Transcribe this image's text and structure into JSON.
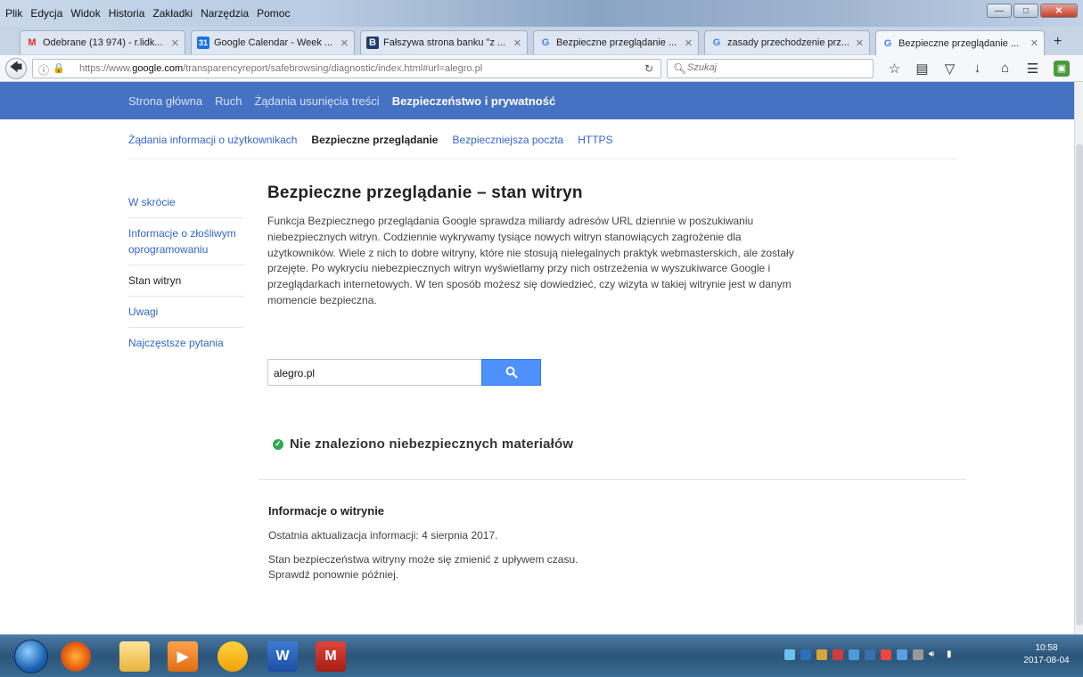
{
  "browser": {
    "menu": [
      "Plik",
      "Edycja",
      "Widok",
      "Historia",
      "Zakładki",
      "Narzędzia",
      "Pomoc"
    ],
    "tabs": [
      {
        "label": "Odebrane (13 974) - r.lidk...",
        "icon": "gmail-icon",
        "color": "#d93025"
      },
      {
        "label": "Google Calendar - Week ...",
        "icon": "calendar-icon",
        "color": "#1a73e8"
      },
      {
        "label": "Fałszywa strona banku \"z ...",
        "icon": "news-icon",
        "color": "#1f3b70"
      },
      {
        "label": "Bezpieczne przeglądanie ...",
        "icon": "google-icon",
        "color": "#4285f4"
      },
      {
        "label": "zasady przechodzenie prz...",
        "icon": "google-icon",
        "color": "#4285f4"
      },
      {
        "label": "Bezpieczne przeglądanie ...",
        "icon": "google-icon",
        "color": "#4285f4",
        "active": true
      }
    ],
    "url_prefix": "https://www.",
    "url_domain": "google.com",
    "url_rest": "/transparencyreport/safebrowsing/diagnostic/index.html#url=alegro.pl",
    "search_placeholder": "Szukaj"
  },
  "page": {
    "top_nav": [
      {
        "label": "Strona główna"
      },
      {
        "label": "Ruch"
      },
      {
        "label": "Żądania usunięcia treści"
      },
      {
        "label": "Bezpieczeństwo i prywatność",
        "active": true
      }
    ],
    "sub_nav": [
      {
        "label": "Żądania informacji o użytkownikach"
      },
      {
        "label": "Bezpieczne przeglądanie",
        "active": true
      },
      {
        "label": "Bezpieczniejsza poczta"
      },
      {
        "label": "HTTPS"
      }
    ],
    "sidebar": [
      {
        "label": "W skrócie"
      },
      {
        "label": "Informacje o złośliwym oprogramowaniu"
      },
      {
        "label": "Stan witryn",
        "active": true
      },
      {
        "label": "Uwagi"
      },
      {
        "label": "Najczęstsze pytania"
      }
    ],
    "title": "Bezpieczne przeglądanie – stan witryn",
    "description": "Funkcja Bezpiecznego przeglądania Google sprawdza miliardy adresów URL dziennie w poszukiwaniu niebezpiecznych witryn. Codziennie wykrywamy tysiące nowych witryn stanowiących zagrożenie dla użytkowników. Wiele z nich to dobre witryny, które nie stosują nielegalnych praktyk webmasterskich, ale zostały przejęte. Po wykryciu niebezpiecznych witryn wyświetlamy przy nich ostrzeżenia w wyszukiwarce Google i przeglądarkach internetowych. W ten sposób możesz się dowiedzieć, czy wizyta w takiej witrynie jest w danym momencie bezpieczna.",
    "search_value": "alegro.pl",
    "result_text": "Nie znaleziono niebezpiecznych materiałów",
    "info_heading": "Informacje o witrynie",
    "info_updated": "Ostatnia aktualizacja informacji: 4 sierpnia 2017.",
    "info_note_1": "Stan bezpieczeństwa witryny może się zmienić z upływem czasu.",
    "info_note_2": "Sprawdź ponownie później."
  },
  "taskbar": {
    "time": "10:58",
    "date": "2017-08-04"
  }
}
